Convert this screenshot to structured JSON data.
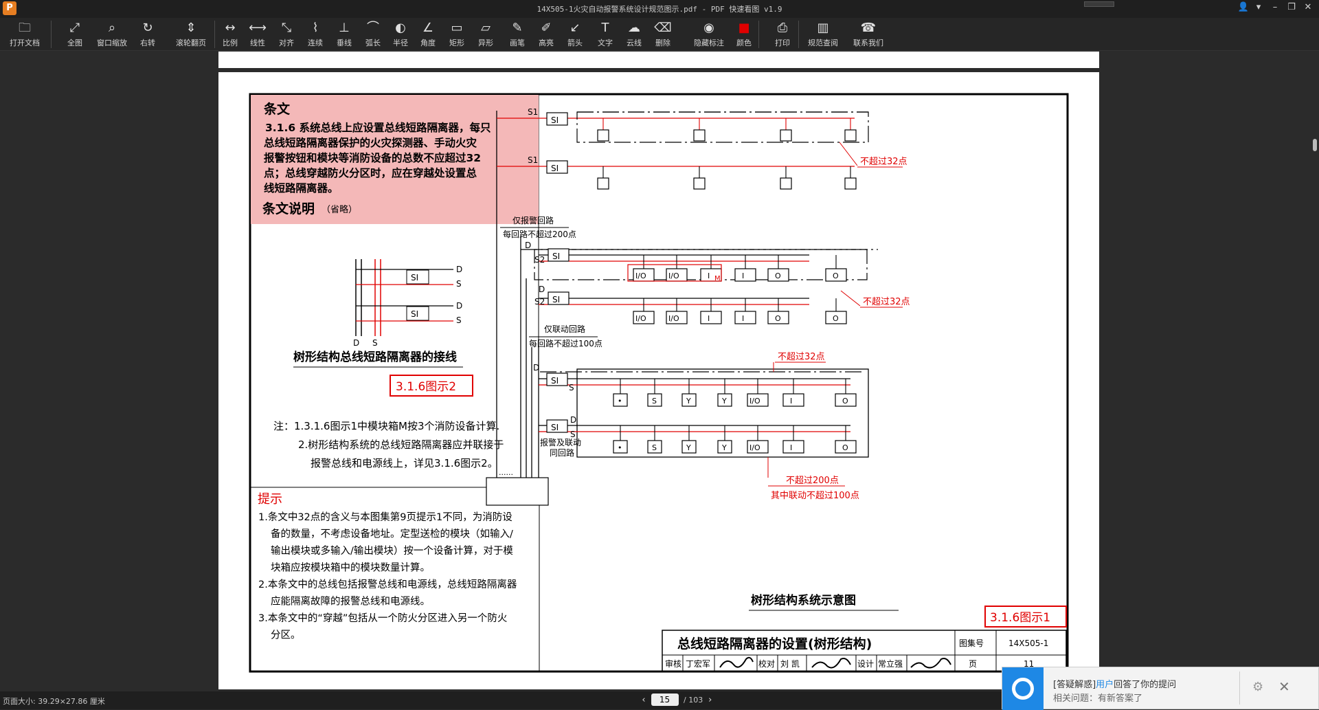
{
  "app": {
    "logo_letter": "P",
    "window_title": "14X505-1火灾自动报警系统设计规范图示.pdf - PDF 快速看图 v1.9",
    "window_controls": [
      "user-icon",
      "chevron-down-icon",
      "minimize-icon",
      "restore-icon",
      "close-icon"
    ]
  },
  "toolbar": {
    "items": [
      {
        "label": "打开文档",
        "icon": "folder-icon",
        "glyph": "🗀"
      },
      {
        "label": "全图",
        "icon": "fit-all-icon",
        "glyph": "⤢"
      },
      {
        "label": "窗口缩放",
        "icon": "zoom-window-icon",
        "glyph": "⌕"
      },
      {
        "label": "右转",
        "icon": "rotate-right-icon",
        "glyph": "↻"
      },
      {
        "label": "滚轮翻页",
        "icon": "scroll-page-icon",
        "glyph": "⇕"
      },
      {
        "label": "比例",
        "icon": "scale-icon",
        "glyph": "↔"
      },
      {
        "label": "线性",
        "icon": "linear-icon",
        "glyph": "⟷"
      },
      {
        "label": "对齐",
        "icon": "align-icon",
        "glyph": "⤡"
      },
      {
        "label": "连续",
        "icon": "continuous-icon",
        "glyph": "⌇"
      },
      {
        "label": "垂线",
        "icon": "perpendicular-icon",
        "glyph": "⊥"
      },
      {
        "label": "弧长",
        "icon": "arc-length-icon",
        "glyph": "⌒"
      },
      {
        "label": "半径",
        "icon": "radius-icon",
        "glyph": "◐"
      },
      {
        "label": "角度",
        "icon": "angle-icon",
        "glyph": "∠"
      },
      {
        "label": "矩形",
        "icon": "rectangle-icon",
        "glyph": "▭"
      },
      {
        "label": "异形",
        "icon": "polygon-icon",
        "glyph": "▱"
      },
      {
        "label": "画笔",
        "icon": "pen-icon",
        "glyph": "✎"
      },
      {
        "label": "高亮",
        "icon": "highlight-icon",
        "glyph": "✐"
      },
      {
        "label": "箭头",
        "icon": "arrow-icon",
        "glyph": "↙"
      },
      {
        "label": "文字",
        "icon": "text-icon",
        "glyph": "T"
      },
      {
        "label": "云线",
        "icon": "cloud-icon",
        "glyph": "☁"
      },
      {
        "label": "删除",
        "icon": "eraser-icon",
        "glyph": "⌫"
      },
      {
        "label": "隐藏标注",
        "icon": "eye-icon",
        "glyph": "◉"
      },
      {
        "label": "颜色",
        "icon": "color-swatch-icon",
        "glyph": "■"
      },
      {
        "label": "打印",
        "icon": "print-icon",
        "glyph": "⎙"
      },
      {
        "label": "规范查阅",
        "icon": "book-icon",
        "glyph": "▥"
      },
      {
        "label": "联系我们",
        "icon": "headset-icon",
        "glyph": "☎"
      }
    ],
    "color_swatch": "#e00000"
  },
  "document": {
    "article_heading": "条文",
    "article_lines": [
      "3.1.6 系统总线上应设置总线短路隔离器，每只",
      "总线短路隔离器保护的火灾探测器、手动火灾",
      "报警按钮和模块等消防设备的总数不应超过32",
      "点；总线穿越防火分区时，应在穿越处设置总",
      "线短路隔离器。"
    ],
    "explanation_heading": "条文说明",
    "explanation_note": "（省略）",
    "wiring_caption": "树形结构总线短路隔离器的接线",
    "figure2_tag": "3.1.6图示2",
    "notes": [
      "注：1.3.1.6图示1中模块箱M按3个消防设备计算.",
      "2.树形结构系统的总线短路隔离器应并联接于",
      "报警总线和电源线上，详见3.1.6图示2。"
    ],
    "tips_heading": "提示",
    "tips_lines": [
      "1.条文中32点的含义与本图集第9页提示1不同，为消防设",
      "备的数量，不考虑设备地址。定型送检的模块（如输入/",
      "输出模块或多输入/输出模块）按一个设备计算，对于模",
      "块箱应按模块箱中的模块数量计算。",
      "2.本条文中的总线包括报警总线和电源线，总线短路隔离器",
      "应能隔离故障的报警总线和电源线。",
      "3.本条文中的“穿越”包括从一个防火分区进入另一个防火",
      "分区。"
    ],
    "diagram": {
      "si": "SI",
      "s1": "S1",
      "s2": "S2",
      "d": "D",
      "s": "S",
      "m": "M",
      "limit32": "不超过32点",
      "alarm_loop": "仅报警回路",
      "alarm_loop_limit": "每回路不超过200点",
      "link_loop": "仅联动回路",
      "link_loop_limit": "每回路不超过100点",
      "combined_loop_1": "报警及联动",
      "combined_loop_2": "同回路",
      "limit200": "不超过200点",
      "link_limit100": "其中联动不超过100点",
      "dots": "......",
      "dev_io": "I/O",
      "dev_i": "I",
      "dev_o": "O",
      "dev_s": "S",
      "dev_y": "Y",
      "dev_dot": "•"
    },
    "system_caption": "树形结构系统示意图",
    "figure1_tag": "3.1.6图示1",
    "title_block": {
      "title": "总线短路隔离器的设置(树形结构)",
      "atlas_label": "图集号",
      "atlas_no": "14X505-1",
      "review_label": "审核",
      "reviewer": "丁宏军",
      "check_label": "校对",
      "checker": "刘 凯",
      "design_label": "设计",
      "designer": "常立强",
      "page_label": "页",
      "page_no": "11"
    }
  },
  "status": {
    "page_size": "页面大小: 39.29×27.86 厘米",
    "current_page": "15",
    "total_pages": "/ 103"
  },
  "notification": {
    "prefix": "[答疑解惑]",
    "highlight": "用户",
    "suffix": "回答了你的提问",
    "related": "相关问题：有新答案了"
  },
  "colors": {
    "red": "#e00000",
    "pink_box": "#f4b8b8",
    "accent": "#1e88e5"
  }
}
